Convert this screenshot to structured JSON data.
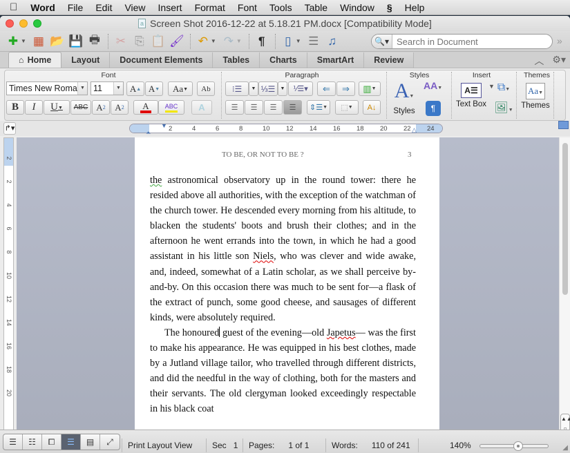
{
  "menubar": {
    "apple": "",
    "app": "Word",
    "items": [
      "File",
      "Edit",
      "View",
      "Insert",
      "Format",
      "Font",
      "Tools",
      "Table",
      "Window",
      "Help"
    ],
    "script_icon": "script-menu-icon"
  },
  "window": {
    "title": "Screen Shot 2016-12-22 at 5.18.21 PM.docx [Compatibility Mode]"
  },
  "toolbar": {
    "icons": [
      "new-document-icon",
      "templates-gallery-icon",
      "open-icon",
      "save-icon",
      "print-icon",
      "cut-icon",
      "copy-icon",
      "paste-icon",
      "format-painter-icon",
      "undo-icon",
      "redo-icon",
      "show-formatting-icon",
      "sidebar-icon",
      "text-box-toolbar-icon",
      "media-browser-icon"
    ],
    "search_placeholder": "Search in Document"
  },
  "tabs": [
    {
      "label": "Home",
      "active": true
    },
    {
      "label": "Layout"
    },
    {
      "label": "Document Elements"
    },
    {
      "label": "Tables"
    },
    {
      "label": "Charts"
    },
    {
      "label": "SmartArt"
    },
    {
      "label": "Review"
    }
  ],
  "ribbon": {
    "groups": {
      "font": "Font",
      "paragraph": "Paragraph",
      "styles": "Styles",
      "insert": "Insert",
      "themes": "Themes"
    },
    "font_name": "Times New Roman",
    "font_size": "11",
    "styles_label": "Styles",
    "text_box_label": "Text Box",
    "themes_label": "Themes",
    "font_color": "#e00000",
    "highlight_color": "#f2e600"
  },
  "ruler": {
    "h_ticks": [
      "2",
      "4",
      "6",
      "8",
      "10",
      "12",
      "14",
      "16",
      "18",
      "20",
      "22",
      "24"
    ],
    "v_ticks": [
      "2",
      "2",
      "4",
      "6",
      "8",
      "10",
      "12",
      "14",
      "16",
      "18",
      "20"
    ]
  },
  "document": {
    "header_title": "TO BE, OR NOT TO BE ?",
    "page_number": "3",
    "p1_first_word": "the",
    "p1_a": " astronomical observatory up in the round tower: there he resided above all authorities, with the exception of the watchman of the church tower. He descended every morning from his altitude, to blacken the students' boots and brush their clothes; and in the afternoon he went errands into the town, in which he had a good assistant in his little son ",
    "p1_name": "Niels",
    "p1_b": ", who was clever and wide awake, and, indeed, somewhat of a Latin scholar, as we shall perceive by-and-by. On this occasion there was much to be sent for—a flask of the extract of punch, some good cheese, and sausages of different kinds, were absolutely required.",
    "p2_a": "The honoured",
    "p2_b": " guest of the evening—old ",
    "p2_name": "Japetus",
    "p2_c": "— was the first to make his appearance. He was equipped in his best clothes, made by a Jutland village tailor, who travelled through different districts, and did the needful in the way of clothing, both for the masters and their servants. The old clergyman looked exceedingly respectable in his black coat"
  },
  "statusbar": {
    "view": "Print Layout View",
    "sec_label": "Sec",
    "sec_value": "1",
    "pages_label": "Pages:",
    "pages_value": "1 of 1",
    "words_label": "Words:",
    "words_value": "110 of 241",
    "zoom": "140%",
    "zoom_slider_fraction": 0.55
  }
}
